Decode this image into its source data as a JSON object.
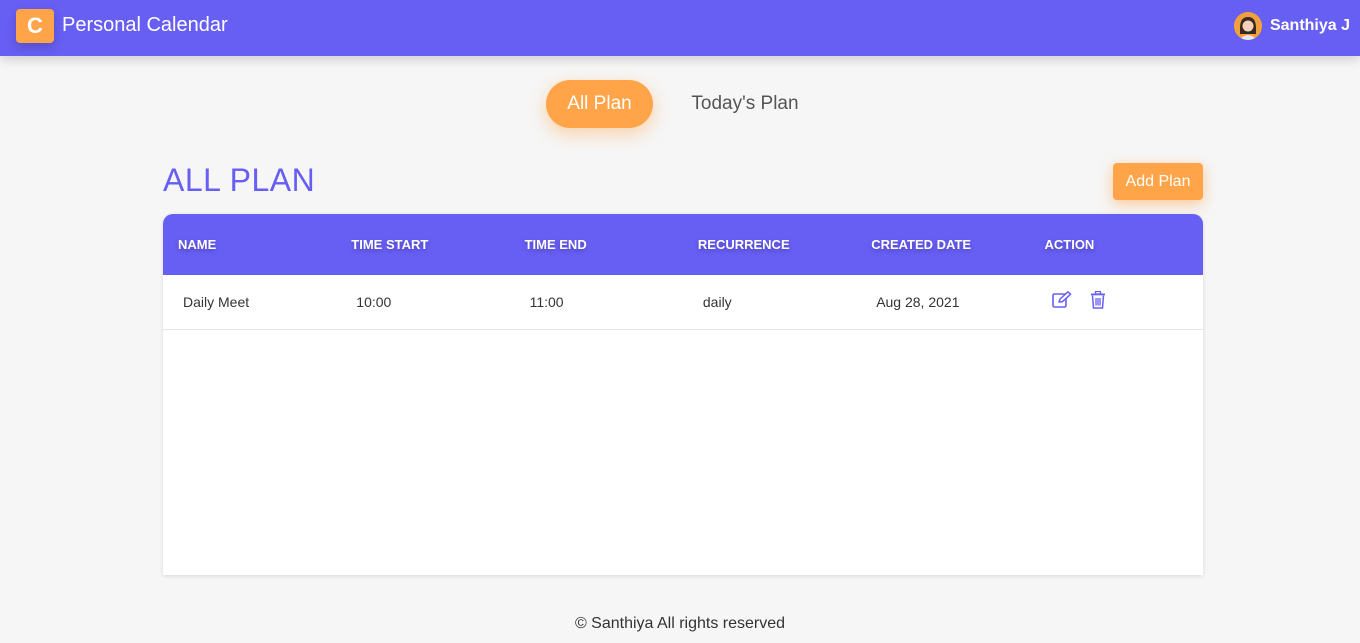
{
  "header": {
    "logo_letter": "C",
    "title": "Personal Calendar",
    "user_name": "Santhiya J",
    "brand_color": "#675ef3",
    "accent_color": "#ffa448"
  },
  "tabs": [
    {
      "label": "All Plan",
      "active": true
    },
    {
      "label": "Today's Plan",
      "active": false
    }
  ],
  "main": {
    "section_title": "ALL PLAN",
    "add_button_label": "Add Plan"
  },
  "table": {
    "columns": [
      "NAME",
      "TIME START",
      "TIME END",
      "RECURRENCE",
      "CREATED DATE",
      "ACTION"
    ],
    "rows": [
      {
        "name": "Daily Meet",
        "time_start": "10:00",
        "time_end": "11:00",
        "recurrence": "daily",
        "created_date": "Aug 28, 2021",
        "actions": [
          "edit-icon",
          "trash-icon"
        ]
      }
    ]
  },
  "footer": {
    "text": "© Santhiya All rights reserved"
  }
}
